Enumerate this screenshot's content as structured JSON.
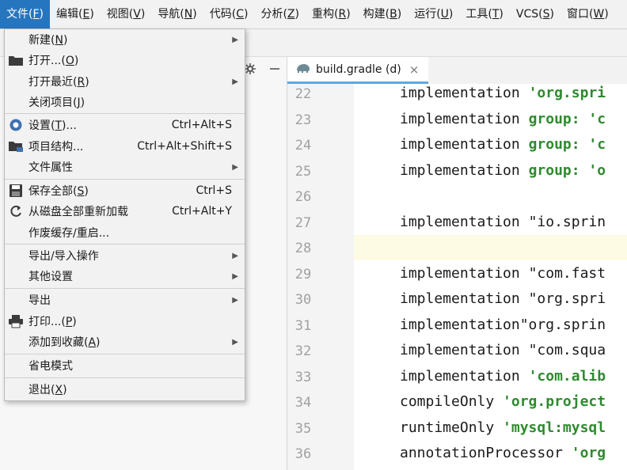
{
  "menubar": {
    "items": [
      {
        "label": "文件(",
        "key": "F",
        "suffix": ")"
      },
      {
        "label": "编辑(",
        "key": "E",
        "suffix": ")"
      },
      {
        "label": "视图(",
        "key": "V",
        "suffix": ")"
      },
      {
        "label": "导航(",
        "key": "N",
        "suffix": ")"
      },
      {
        "label": "代码(",
        "key": "C",
        "suffix": ")"
      },
      {
        "label": "分析(",
        "key": "Z",
        "suffix": ")"
      },
      {
        "label": "重构(",
        "key": "R",
        "suffix": ")"
      },
      {
        "label": "构建(",
        "key": "B",
        "suffix": ")"
      },
      {
        "label": "运行(",
        "key": "U",
        "suffix": ")"
      },
      {
        "label": "工具(",
        "key": "T",
        "suffix": ")"
      },
      {
        "label": "VCS(",
        "key": "S",
        "suffix": ")"
      },
      {
        "label": "窗口(",
        "key": "W",
        "suffix": ")"
      }
    ]
  },
  "file_menu": {
    "items": [
      {
        "label": "新建(",
        "key": "N",
        "suffix": ")",
        "shortcut": "",
        "submenu": true,
        "icon": ""
      },
      {
        "label": "打开...(",
        "key": "O",
        "suffix": ")",
        "shortcut": "",
        "submenu": false,
        "icon": "folder-icon"
      },
      {
        "label": "打开最近(",
        "key": "R",
        "suffix": ")",
        "shortcut": "",
        "submenu": true,
        "icon": ""
      },
      {
        "label": "关闭项目(",
        "key": "J",
        "suffix": ")",
        "shortcut": "",
        "submenu": false,
        "icon": ""
      },
      {
        "label": "设置(",
        "key": "T",
        "suffix": ")...",
        "shortcut": "Ctrl+Alt+S",
        "submenu": false,
        "icon": "gear-icon"
      },
      {
        "label": "项目结构...",
        "key": "",
        "suffix": "",
        "shortcut": "Ctrl+Alt+Shift+S",
        "submenu": false,
        "icon": "project-structure-icon"
      },
      {
        "label": "文件属性",
        "key": "",
        "suffix": "",
        "shortcut": "",
        "submenu": true,
        "icon": ""
      },
      {
        "label": "保存全部(",
        "key": "S",
        "suffix": ")",
        "shortcut": "Ctrl+S",
        "submenu": false,
        "icon": "save-icon"
      },
      {
        "label": "从磁盘全部重新加载",
        "key": "",
        "suffix": "",
        "shortcut": "Ctrl+Alt+Y",
        "submenu": false,
        "icon": "reload-icon"
      },
      {
        "label": "作废缓存/重启...",
        "key": "",
        "suffix": "",
        "shortcut": "",
        "submenu": false,
        "icon": ""
      },
      {
        "label": "导出/导入操作",
        "key": "",
        "suffix": "",
        "shortcut": "",
        "submenu": true,
        "icon": ""
      },
      {
        "label": "其他设置",
        "key": "",
        "suffix": "",
        "shortcut": "",
        "submenu": true,
        "icon": ""
      },
      {
        "label": "导出",
        "key": "",
        "suffix": "",
        "shortcut": "",
        "submenu": true,
        "icon": ""
      },
      {
        "label": "打印...(",
        "key": "P",
        "suffix": ")",
        "shortcut": "",
        "submenu": false,
        "icon": "print-icon"
      },
      {
        "label": "添加到收藏(",
        "key": "A",
        "suffix": ")",
        "shortcut": "",
        "submenu": true,
        "icon": ""
      },
      {
        "label": "省电模式",
        "key": "",
        "suffix": "",
        "shortcut": "",
        "submenu": false,
        "icon": ""
      },
      {
        "label": "退出(",
        "key": "X",
        "suffix": ")",
        "shortcut": "",
        "submenu": false,
        "icon": ""
      }
    ]
  },
  "editor": {
    "tab_label": "build.gradle (d)",
    "tab_close": "×",
    "lines": [
      {
        "num": "22",
        "parts": [
          [
            "plain",
            "implementation "
          ],
          [
            "str",
            "'org.spri"
          ]
        ]
      },
      {
        "num": "23",
        "parts": [
          [
            "plain",
            "implementation "
          ],
          [
            "kw",
            "group: "
          ],
          [
            "str",
            "'c"
          ]
        ]
      },
      {
        "num": "24",
        "parts": [
          [
            "plain",
            "implementation "
          ],
          [
            "kw",
            "group: "
          ],
          [
            "str",
            "'c"
          ]
        ]
      },
      {
        "num": "25",
        "parts": [
          [
            "plain",
            "implementation "
          ],
          [
            "kw",
            "group: "
          ],
          [
            "str",
            "'o"
          ]
        ]
      },
      {
        "num": "26",
        "parts": []
      },
      {
        "num": "27",
        "parts": [
          [
            "plain",
            "implementation "
          ],
          [
            "plain",
            "\"io.sprin"
          ]
        ]
      },
      {
        "num": "28",
        "parts": []
      },
      {
        "num": "29",
        "parts": [
          [
            "plain",
            "implementation "
          ],
          [
            "plain",
            "\"com.fast"
          ]
        ]
      },
      {
        "num": "30",
        "parts": [
          [
            "plain",
            "implementation "
          ],
          [
            "plain",
            "\"org.spri"
          ]
        ]
      },
      {
        "num": "31",
        "parts": [
          [
            "plain",
            "implementation"
          ],
          [
            "plain",
            "\"org.sprin"
          ]
        ]
      },
      {
        "num": "32",
        "parts": [
          [
            "plain",
            "implementation "
          ],
          [
            "plain",
            "\"com.squa"
          ]
        ]
      },
      {
        "num": "33",
        "parts": [
          [
            "plain",
            "implementation "
          ],
          [
            "str",
            "'com.alib"
          ]
        ]
      },
      {
        "num": "34",
        "parts": [
          [
            "plain",
            "compileOnly "
          ],
          [
            "str",
            "'org.project"
          ]
        ]
      },
      {
        "num": "35",
        "parts": [
          [
            "plain",
            "runtimeOnly "
          ],
          [
            "str",
            "'mysql:mysql"
          ]
        ]
      },
      {
        "num": "36",
        "parts": [
          [
            "plain",
            "annotationProcessor "
          ],
          [
            "str",
            "'org"
          ]
        ]
      }
    ]
  }
}
